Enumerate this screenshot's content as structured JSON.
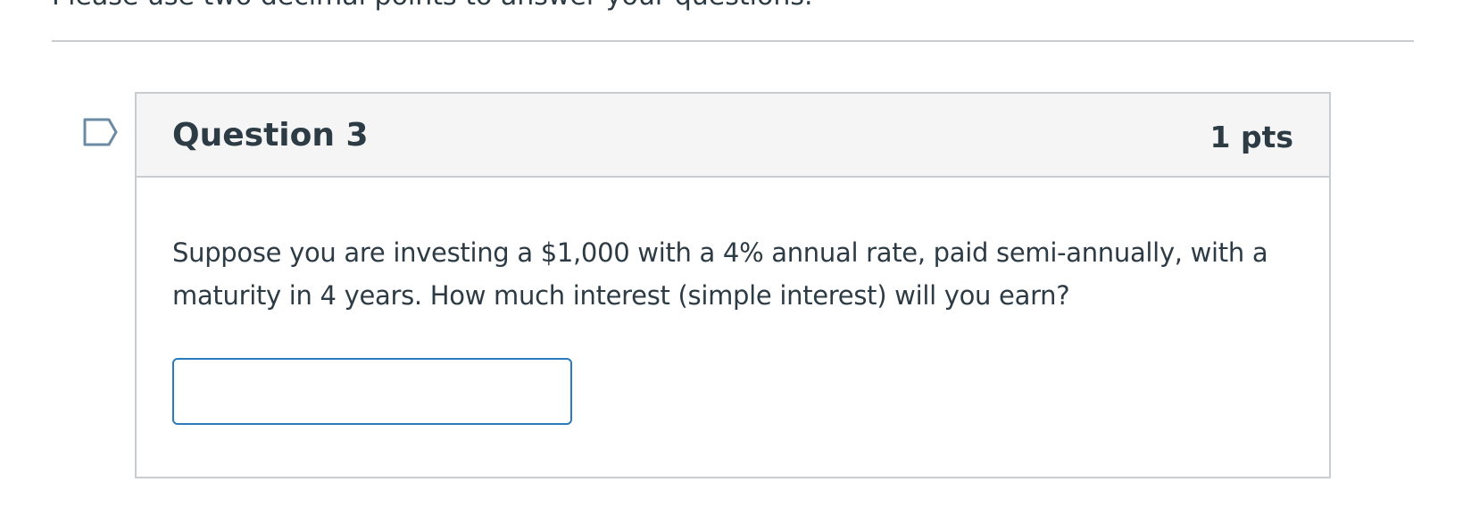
{
  "quiz": {
    "instructions": "Please use two decimal points to answer your questions."
  },
  "question": {
    "title": "Question 3",
    "points": "1 pts",
    "text": "Suppose you are investing a $1,000 with a 4% annual rate, paid semi-annually, with a maturity in 4 years. How much interest (simple interest) will you earn?",
    "answer_value": "",
    "flag_icon": "flag-question-icon"
  },
  "colors": {
    "text": "#2d3b45",
    "border": "#c7cdd1",
    "header_bg": "#f5f5f5",
    "input_border": "#2b7abc",
    "flag_icon": "#6b8aa3"
  }
}
